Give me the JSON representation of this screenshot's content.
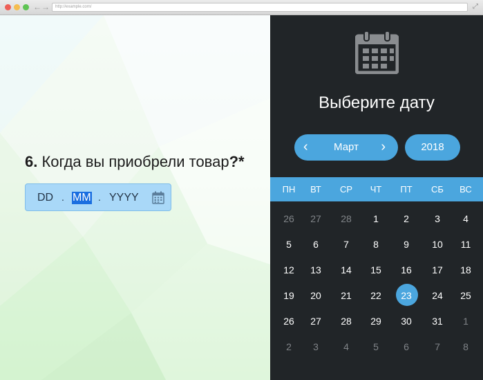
{
  "browser": {
    "url": "http://example.com/"
  },
  "question": {
    "number": "6.",
    "text": "Когда вы приобрели товар",
    "required_mark": "?*"
  },
  "date_input": {
    "day_placeholder": "DD",
    "month_placeholder": "MM",
    "year_placeholder": "YYYY",
    "separator": "."
  },
  "picker": {
    "title": "Выберите дату",
    "month": "Март",
    "year": "2018",
    "prev_arrow": "‹",
    "next_arrow": "›",
    "weekdays": [
      "ПН",
      "ВТ",
      "СР",
      "ЧТ",
      "ПТ",
      "СБ",
      "ВС"
    ],
    "weeks": [
      [
        "26",
        "27",
        "28",
        "1",
        "2",
        "3",
        "4"
      ],
      [
        "5",
        "6",
        "7",
        "8",
        "9",
        "10",
        "11"
      ],
      [
        "12",
        "13",
        "14",
        "15",
        "16",
        "17",
        "18"
      ],
      [
        "19",
        "20",
        "21",
        "22",
        "23",
        "24",
        "25"
      ],
      [
        "26",
        "27",
        "28",
        "29",
        "30",
        "31",
        "1"
      ],
      [
        "2",
        "3",
        "4",
        "5",
        "6",
        "7",
        "8"
      ]
    ],
    "selected_day": "23",
    "accent_color": "#4ba6de",
    "panel_color": "#212528"
  }
}
